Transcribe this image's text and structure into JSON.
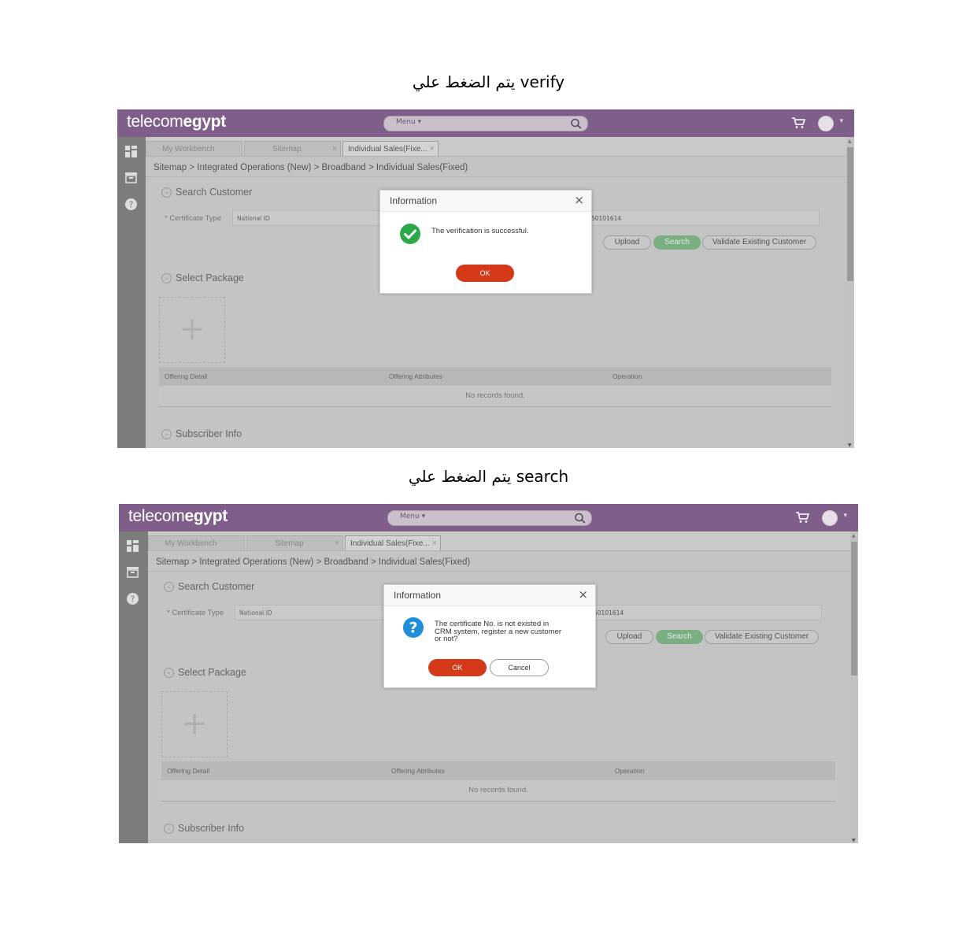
{
  "captions": {
    "first": "يتم الضغط علي verify",
    "second": "يتم الضغط علي search"
  },
  "app": {
    "logo_light": "telecom",
    "logo_bold": "egypt",
    "menu_label": "Menu ▾",
    "brand_color": "#7f5f8a"
  },
  "tabs": [
    {
      "label": "My Workbench"
    },
    {
      "label": "Sitemap"
    },
    {
      "label": "Individual Sales(Fixe..."
    }
  ],
  "breadcrumb": "Sitemap > Integrated Operations (New) > Broadband > Individual Sales(Fixed)",
  "search_customer": {
    "title": "Search Customer",
    "certificate_type_label": "* Certificate Type",
    "certificate_type_value": "National ID",
    "certificate_no_partial": "50101614",
    "buttons": {
      "upload": "Upload",
      "search": "Search",
      "validate": "Validate Existing Customer"
    }
  },
  "select_package": {
    "title": "Select Package",
    "table_headers": [
      "Offering Detail",
      "Offering Attributes",
      "Operation"
    ],
    "empty_text": "No records found."
  },
  "subscriber_info": {
    "title": "Subscriber Info"
  },
  "dialog_verify": {
    "title": "Information",
    "message": "The verification is successful.",
    "ok": "OK",
    "icon": "check-circle-icon"
  },
  "dialog_search": {
    "title": "Information",
    "message_line1": "The certificate No. is not existed in",
    "message_line2": "CRM system, register a new customer",
    "message_line3": "or not?",
    "ok": "OK",
    "cancel": "Cancel",
    "icon": "question-circle-icon"
  }
}
